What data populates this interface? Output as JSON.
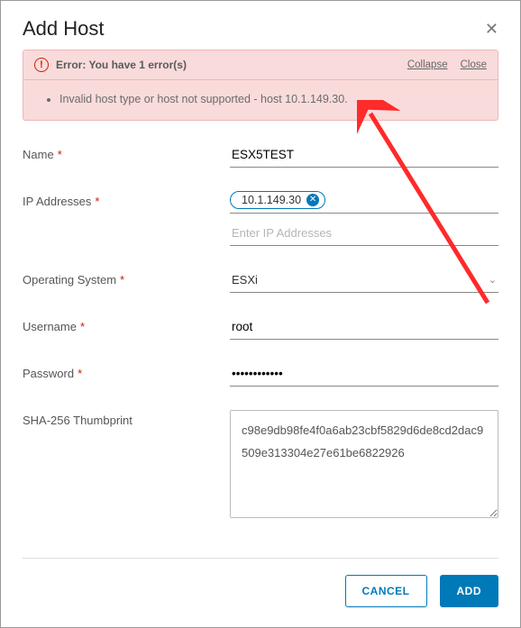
{
  "header": {
    "title": "Add Host"
  },
  "error": {
    "title": "Error: You have 1 error(s)",
    "collapse": "Collapse",
    "close": "Close",
    "message": "Invalid host type or host not supported - host 10.1.149.30."
  },
  "form": {
    "name_label": "Name",
    "name_value": "ESX5TEST",
    "ip_label": "IP Addresses",
    "ip_chip": "10.1.149.30",
    "ip_placeholder": "Enter IP Addresses",
    "os_label": "Operating System",
    "os_value": "ESXi",
    "user_label": "Username",
    "user_value": "root",
    "pw_label": "Password",
    "pw_value": "••••••••••••",
    "thumb_label": "SHA-256 Thumbprint",
    "thumb_value": "c98e9db98fe4f0a6ab23cbf5829d6de8cd2dac9509e313304e27e61be6822926"
  },
  "footer": {
    "cancel": "CANCEL",
    "add": "ADD"
  }
}
